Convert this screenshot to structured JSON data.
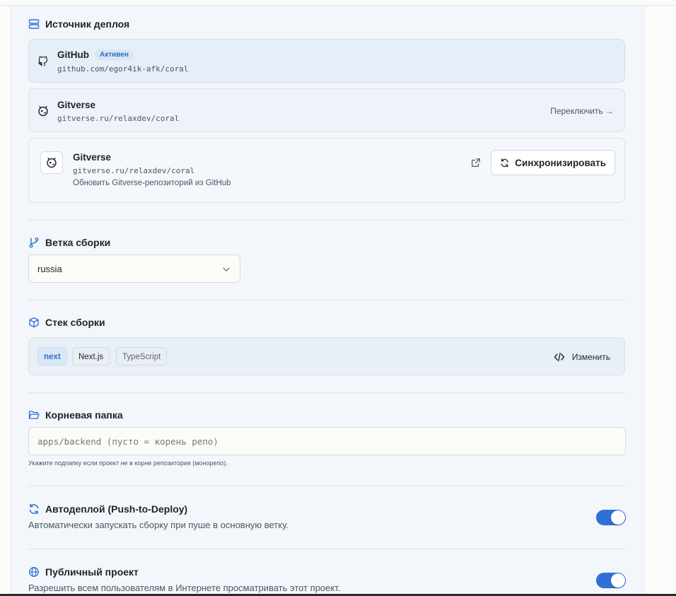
{
  "deploy_source": {
    "title": "Источник деплоя",
    "repos": [
      {
        "provider": "GitHub",
        "badge": "Активен",
        "url": "github.com/egor4ik-afk/coral"
      },
      {
        "provider": "Gitverse",
        "url": "gitverse.ru/relaxdev/coral",
        "action": "Переключить →"
      }
    ],
    "sync": {
      "provider": "Gitverse",
      "url": "gitverse.ru/relaxdev/coral",
      "description": "Обновить Gitverse-репозиторий из GitHub",
      "button": "Синхронизировать"
    }
  },
  "branch": {
    "title": "Ветка сборки",
    "selected": "russia"
  },
  "stack": {
    "title": "Стек сборки",
    "tags": [
      "next",
      "Next.js",
      "TypeScript"
    ],
    "edit_label": "Изменить"
  },
  "root_folder": {
    "title": "Корневая папка",
    "placeholder": "apps/backend (пусто = корень репо)",
    "value": "",
    "hint": "Укажите подпапку если проект не в корне репозитория (монорепо)."
  },
  "autodeploy": {
    "title": "Автодеплой (Push-to-Deploy)",
    "description": "Автоматически запускать сборку при пуше в основную ветку.",
    "enabled": true
  },
  "public_project": {
    "title": "Публичный проект",
    "description": "Разрешить всем пользователям в Интернете просматривать этот проект.",
    "enabled": true
  },
  "colors": {
    "accent": "#2f6fd6",
    "badge_text": "#2f6fbf",
    "panel_bg": "#f3f7fb"
  }
}
